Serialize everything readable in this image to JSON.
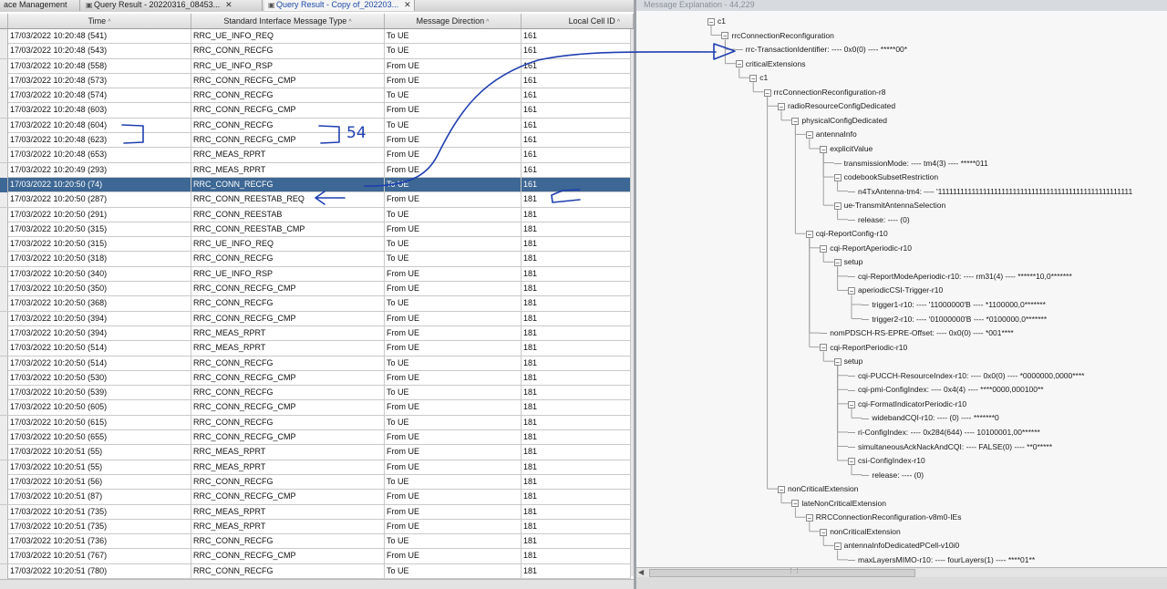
{
  "tabs": [
    {
      "label": "ace Management",
      "icon": "",
      "active": false
    },
    {
      "label": "Query Result - 20220316_08453...",
      "icon": "document-icon",
      "active": false
    },
    {
      "label": "Query Result - Copy of_202203...",
      "icon": "document-icon",
      "active": true
    }
  ],
  "table": {
    "columns": [
      {
        "label": "Time",
        "sort": "^"
      },
      {
        "label": "Standard Interface Message Type",
        "sort": "^"
      },
      {
        "label": "Message Direction",
        "sort": "^"
      },
      {
        "label": "Local Cell ID",
        "sort": "^"
      }
    ],
    "selected_index": 10,
    "rows": [
      [
        "17/03/2022 10:20:48 (541)",
        "RRC_UE_INFO_REQ",
        "To UE",
        "161"
      ],
      [
        "17/03/2022 10:20:48 (543)",
        "RRC_CONN_RECFG",
        "To UE",
        "161"
      ],
      [
        "17/03/2022 10:20:48 (558)",
        "RRC_UE_INFO_RSP",
        "From UE",
        "161"
      ],
      [
        "17/03/2022 10:20:48 (573)",
        "RRC_CONN_RECFG_CMP",
        "From UE",
        "161"
      ],
      [
        "17/03/2022 10:20:48 (574)",
        "RRC_CONN_RECFG",
        "To UE",
        "161"
      ],
      [
        "17/03/2022 10:20:48 (603)",
        "RRC_CONN_RECFG_CMP",
        "From UE",
        "161"
      ],
      [
        "17/03/2022 10:20:48 (604)",
        "RRC_CONN_RECFG",
        "To UE",
        "161"
      ],
      [
        "17/03/2022 10:20:48 (623)",
        "RRC_CONN_RECFG_CMP",
        "From UE",
        "161"
      ],
      [
        "17/03/2022 10:20:48 (653)",
        "RRC_MEAS_RPRT",
        "From UE",
        "161"
      ],
      [
        "17/03/2022 10:20:49 (293)",
        "RRC_MEAS_RPRT",
        "From UE",
        "161"
      ],
      [
        "17/03/2022 10:20:50 (74)",
        "RRC_CONN_RECFG",
        "To UE",
        "161"
      ],
      [
        "17/03/2022 10:20:50 (287)",
        "RRC_CONN_REESTAB_REQ",
        "From UE",
        "181"
      ],
      [
        "17/03/2022 10:20:50 (291)",
        "RRC_CONN_REESTAB",
        "To UE",
        "181"
      ],
      [
        "17/03/2022 10:20:50 (315)",
        "RRC_CONN_REESTAB_CMP",
        "From UE",
        "181"
      ],
      [
        "17/03/2022 10:20:50 (315)",
        "RRC_UE_INFO_REQ",
        "To UE",
        "181"
      ],
      [
        "17/03/2022 10:20:50 (318)",
        "RRC_CONN_RECFG",
        "To UE",
        "181"
      ],
      [
        "17/03/2022 10:20:50 (340)",
        "RRC_UE_INFO_RSP",
        "From UE",
        "181"
      ],
      [
        "17/03/2022 10:20:50 (350)",
        "RRC_CONN_RECFG_CMP",
        "From UE",
        "181"
      ],
      [
        "17/03/2022 10:20:50 (368)",
        "RRC_CONN_RECFG",
        "To UE",
        "181"
      ],
      [
        "17/03/2022 10:20:50 (394)",
        "RRC_CONN_RECFG_CMP",
        "From UE",
        "181"
      ],
      [
        "17/03/2022 10:20:50 (394)",
        "RRC_MEAS_RPRT",
        "From UE",
        "181"
      ],
      [
        "17/03/2022 10:20:50 (514)",
        "RRC_MEAS_RPRT",
        "From UE",
        "181"
      ],
      [
        "17/03/2022 10:20:50 (514)",
        "RRC_CONN_RECFG",
        "To UE",
        "181"
      ],
      [
        "17/03/2022 10:20:50 (530)",
        "RRC_CONN_RECFG_CMP",
        "From UE",
        "181"
      ],
      [
        "17/03/2022 10:20:50 (539)",
        "RRC_CONN_RECFG",
        "To UE",
        "181"
      ],
      [
        "17/03/2022 10:20:50 (605)",
        "RRC_CONN_RECFG_CMP",
        "From UE",
        "181"
      ],
      [
        "17/03/2022 10:20:50 (615)",
        "RRC_CONN_RECFG",
        "To UE",
        "181"
      ],
      [
        "17/03/2022 10:20:50 (655)",
        "RRC_CONN_RECFG_CMP",
        "From UE",
        "181"
      ],
      [
        "17/03/2022 10:20:51 (55)",
        "RRC_MEAS_RPRT",
        "From UE",
        "181"
      ],
      [
        "17/03/2022 10:20:51 (55)",
        "RRC_MEAS_RPRT",
        "From UE",
        "181"
      ],
      [
        "17/03/2022 10:20:51 (56)",
        "RRC_CONN_RECFG",
        "To UE",
        "181"
      ],
      [
        "17/03/2022 10:20:51 (87)",
        "RRC_CONN_RECFG_CMP",
        "From UE",
        "181"
      ],
      [
        "17/03/2022 10:20:51 (735)",
        "RRC_MEAS_RPRT",
        "From UE",
        "181"
      ],
      [
        "17/03/2022 10:20:51 (735)",
        "RRC_MEAS_RPRT",
        "From UE",
        "181"
      ],
      [
        "17/03/2022 10:20:51 (736)",
        "RRC_CONN_RECFG",
        "To UE",
        "181"
      ],
      [
        "17/03/2022 10:20:51 (767)",
        "RRC_CONN_RECFG_CMP",
        "From UE",
        "181"
      ],
      [
        "17/03/2022 10:20:51 (780)",
        "RRC_CONN_RECFG",
        "To UE",
        "181"
      ]
    ]
  },
  "explanation": {
    "title": "Message Explanation - 44,229",
    "nodes": [
      {
        "depth": 0,
        "text": "c1",
        "expander": "-"
      },
      {
        "depth": 1,
        "text": "rrcConnectionReconfiguration",
        "expander": "-"
      },
      {
        "depth": 2,
        "text": "rrc-TransactionIdentifier: ---- 0x0(0) ---- *****00*",
        "expander": ""
      },
      {
        "depth": 2,
        "text": "criticalExtensions",
        "expander": "-"
      },
      {
        "depth": 3,
        "text": "c1",
        "expander": "-"
      },
      {
        "depth": 4,
        "text": "rrcConnectionReconfiguration-r8",
        "expander": "-"
      },
      {
        "depth": 5,
        "text": "radioResourceConfigDedicated",
        "expander": "-"
      },
      {
        "depth": 6,
        "text": "physicalConfigDedicated",
        "expander": "-"
      },
      {
        "depth": 7,
        "text": "antennaInfo",
        "expander": "-"
      },
      {
        "depth": 8,
        "text": "explicitValue",
        "expander": "-"
      },
      {
        "depth": 9,
        "text": "transmissionMode: ---- tm4(3) ---- *****011",
        "expander": ""
      },
      {
        "depth": 9,
        "text": "codebookSubsetRestriction",
        "expander": "-"
      },
      {
        "depth": 10,
        "text": "n4TxAntenna-tm4: ---- '1111111111111111111111111111111111111111111111111111",
        "expander": ""
      },
      {
        "depth": 9,
        "text": "ue-TransmitAntennaSelection",
        "expander": "-"
      },
      {
        "depth": 10,
        "text": "release: ---- (0)",
        "expander": ""
      },
      {
        "depth": 7,
        "text": "cqi-ReportConfig-r10",
        "expander": "-"
      },
      {
        "depth": 8,
        "text": "cqi-ReportAperiodic-r10",
        "expander": "-"
      },
      {
        "depth": 9,
        "text": "setup",
        "expander": "-"
      },
      {
        "depth": 10,
        "text": "cqi-ReportModeAperiodic-r10: ---- rm31(4) ---- ******10,0*******",
        "expander": ""
      },
      {
        "depth": 10,
        "text": "aperiodicCSI-Trigger-r10",
        "expander": "-"
      },
      {
        "depth": 11,
        "text": "trigger1-r10: ---- '11000000'B ---- *1100000,0*******",
        "expander": ""
      },
      {
        "depth": 11,
        "text": "trigger2-r10: ---- '01000000'B ---- *0100000,0*******",
        "expander": ""
      },
      {
        "depth": 8,
        "text": "nomPDSCH-RS-EPRE-Offset: ---- 0x0(0) ---- *001****",
        "expander": ""
      },
      {
        "depth": 8,
        "text": "cqi-ReportPeriodic-r10",
        "expander": "-"
      },
      {
        "depth": 9,
        "text": "setup",
        "expander": "-"
      },
      {
        "depth": 10,
        "text": "cqi-PUCCH-ResourceIndex-r10: ---- 0x0(0) ---- *0000000,0000****",
        "expander": ""
      },
      {
        "depth": 10,
        "text": "cqi-pmi-ConfigIndex: ---- 0x4(4) ---- ****0000,000100**",
        "expander": ""
      },
      {
        "depth": 10,
        "text": "cqi-FormatIndicatorPeriodic-r10",
        "expander": "-"
      },
      {
        "depth": 11,
        "text": "widebandCQI-r10: ---- (0) ---- *******0",
        "expander": ""
      },
      {
        "depth": 10,
        "text": "ri-ConfigIndex: ---- 0x284(644) ---- 10100001,00******",
        "expander": ""
      },
      {
        "depth": 10,
        "text": "simultaneousAckNackAndCQI: ---- FALSE(0) ---- **0*****",
        "expander": ""
      },
      {
        "depth": 10,
        "text": "csi-ConfigIndex-r10",
        "expander": "-"
      },
      {
        "depth": 11,
        "text": "release: ---- (0)",
        "expander": ""
      },
      {
        "depth": 5,
        "text": "nonCriticalExtension",
        "expander": "-"
      },
      {
        "depth": 6,
        "text": "lateNonCriticalExtension",
        "expander": "-"
      },
      {
        "depth": 7,
        "text": "RRCConnectionReconfiguration-v8m0-IEs",
        "expander": "-"
      },
      {
        "depth": 8,
        "text": "nonCriticalExtension",
        "expander": "-"
      },
      {
        "depth": 9,
        "text": "antennaInfoDedicatedPCell-v10i0",
        "expander": "-"
      },
      {
        "depth": 10,
        "text": "maxLayersMIMO-r10: ---- fourLayers(1) ---- ****01**",
        "expander": ""
      }
    ]
  },
  "annotations": {
    "handwritten_note": "54",
    "ink_color": "#1f3fb0"
  },
  "colors": {
    "selected_row": "#3d6794",
    "active_tab_text": "#1e49a8"
  }
}
